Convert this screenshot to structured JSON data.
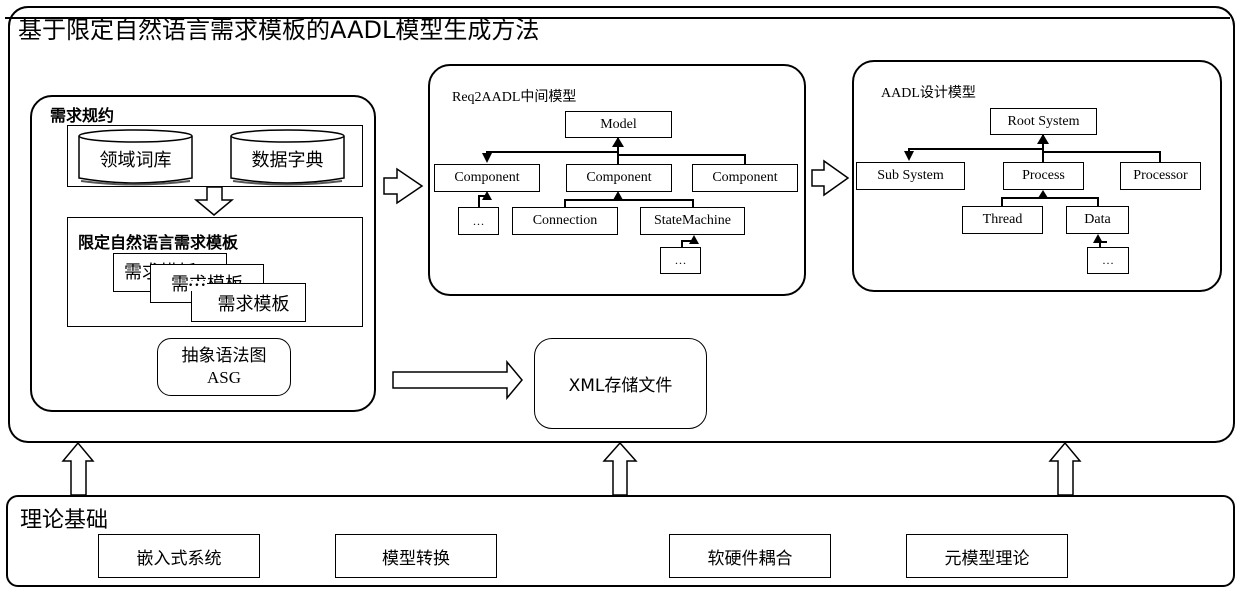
{
  "title": "基于限定自然语言需求模板的AADL模型生成方法",
  "spec_panel": {
    "title": "需求规约",
    "databases": [
      "领域词库",
      "数据字典"
    ],
    "template_section": {
      "title": "限定自然语言需求模板",
      "cards": [
        "需求模板",
        "需求模板",
        "需求模板"
      ],
      "ellipsis": "•••"
    },
    "asg": {
      "line1": "抽象语法图",
      "line2": "ASG"
    }
  },
  "intermediate_model": {
    "title": "Req2AADL中间模型",
    "root": "Model",
    "components": [
      "Component",
      "Component",
      "Component"
    ],
    "sub_left": "…",
    "children": [
      "Connection",
      "StateMachine"
    ],
    "sub_state": "…"
  },
  "design_model": {
    "title": "AADL设计模型",
    "root": "Root System",
    "level1": [
      "Sub System",
      "Process",
      "Processor"
    ],
    "level2": [
      "Thread",
      "Data"
    ],
    "sub_data": "…"
  },
  "xml_storage": "XML存储文件",
  "theory": {
    "title": "理论基础",
    "items": [
      "嵌入式系统",
      "模型转换",
      "软硬件耦合",
      "元模型理论"
    ]
  }
}
